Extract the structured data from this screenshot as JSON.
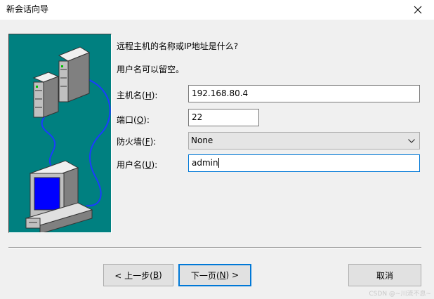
{
  "window": {
    "title": "新会话向导",
    "close_glyph": "✕"
  },
  "prompt": {
    "line1": "远程主机的名称或IP地址是什么?",
    "line2": "用户名可以留空。"
  },
  "form": {
    "host": {
      "label": "主机名",
      "mnemonic": "H",
      "value": "192.168.80.4"
    },
    "port": {
      "label": "端口",
      "mnemonic": "O",
      "value": "22"
    },
    "firewall": {
      "label": "防火墙",
      "mnemonic": "F",
      "value": "None"
    },
    "username": {
      "label": "用户名",
      "mnemonic": "U",
      "value": "admin"
    }
  },
  "buttons": {
    "back": {
      "prefix": "< 上一步(",
      "mnemonic": "B",
      "suffix": ")"
    },
    "next": {
      "prefix": "下一页(",
      "mnemonic": "N",
      "suffix": ") >"
    },
    "cancel": {
      "label": "取消"
    }
  },
  "watermark": "CSDN @~川流不息~",
  "colors": {
    "illustration_bg": "#008080",
    "focus_border": "#0078d7",
    "monitor_screen": "#0000ff",
    "cable": "#1a3cff"
  }
}
